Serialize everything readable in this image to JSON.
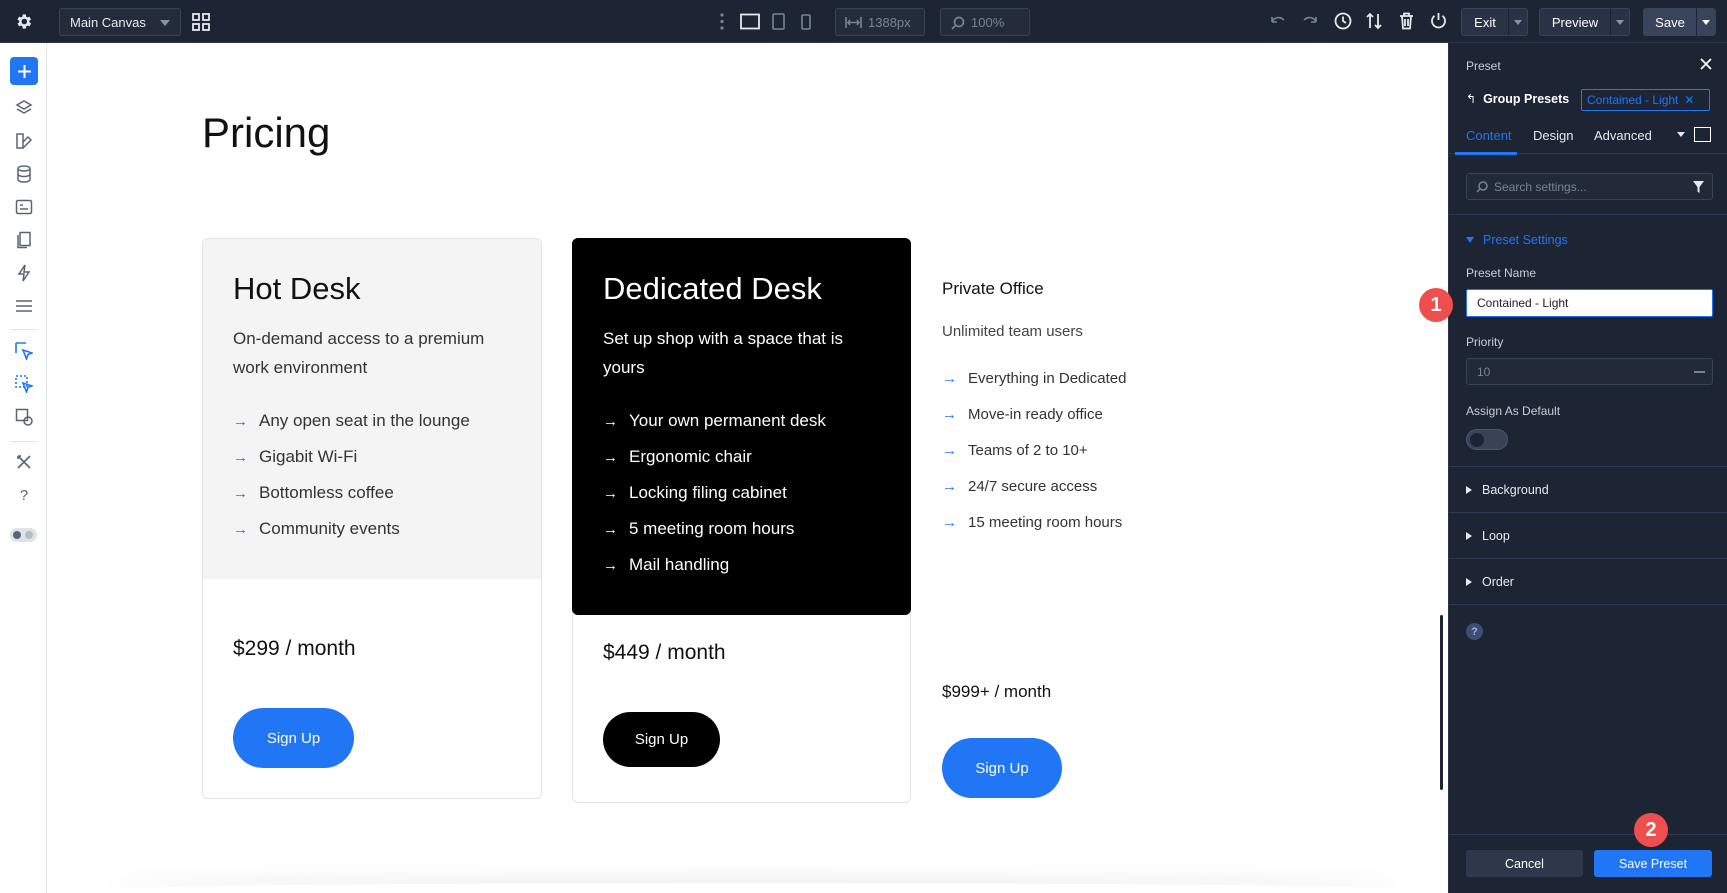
{
  "topbar": {
    "canvas_select": "Main Canvas",
    "width_value": "1388px",
    "zoom_value": "100%",
    "exit_label": "Exit",
    "preview_label": "Preview",
    "save_label": "Save"
  },
  "canvas": {
    "heading": "Pricing",
    "plans": [
      {
        "title": "Hot Desk",
        "description": "On-demand access to a premium work environment",
        "features": [
          "Any open seat in the lounge",
          "Gigabit Wi-Fi",
          "Bottomless coffee",
          "Community events"
        ],
        "price": "$299 / month",
        "button": "Sign Up"
      },
      {
        "title": "Dedicated Desk",
        "description": "Set up shop with a space that is yours",
        "features": [
          "Your own permanent desk",
          "Ergonomic chair",
          "Locking filing cabinet",
          "5 meeting room hours",
          "Mail handling"
        ],
        "price": "$449 / month",
        "button": "Sign Up"
      },
      {
        "title": "Private Office",
        "description": "Unlimited team users",
        "features": [
          "Everything in Dedicated",
          "Move-in ready office",
          "Teams of 2 to 10+",
          "24/7 secure access",
          "15 meeting room hours"
        ],
        "price": "$999+ / month",
        "button": "Sign Up"
      }
    ]
  },
  "panel": {
    "title": "Preset",
    "back_label": "Group Presets",
    "preset_tag": "Contained - Light",
    "tabs": [
      "Content",
      "Design",
      "Advanced"
    ],
    "active_tab": "Content",
    "search_placeholder": "Search settings...",
    "section_open": "Preset Settings",
    "preset_name_label": "Preset Name",
    "preset_name_value": "Contained - Light",
    "priority_label": "Priority",
    "priority_value": "10",
    "assign_default_label": "Assign As Default",
    "assign_default_on": false,
    "sections": [
      "Background",
      "Loop",
      "Order"
    ],
    "cancel_label": "Cancel",
    "save_preset_label": "Save Preset"
  },
  "annotations": [
    "1",
    "2"
  ],
  "colors": {
    "accent": "#2176f5",
    "dark_bar": "#1d2433",
    "card_light_bg": "#f4f4f4",
    "card_dark_bg": "#000000",
    "badge": "#ef4e4e"
  }
}
